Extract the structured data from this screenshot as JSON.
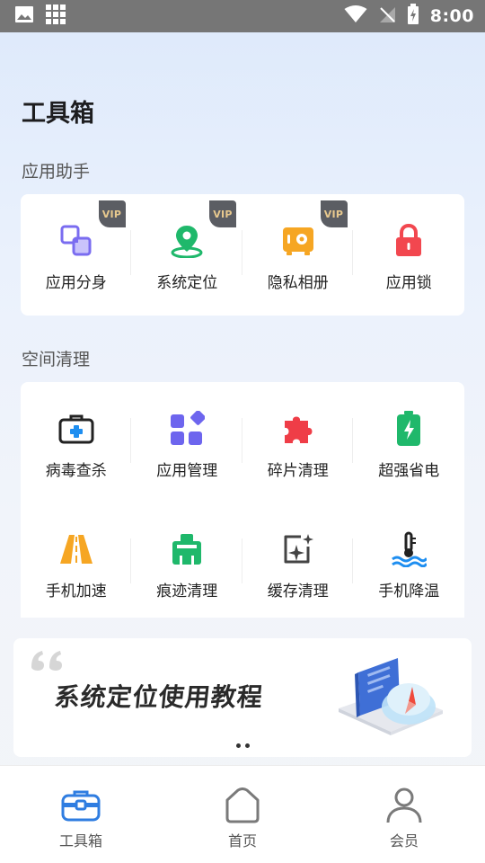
{
  "status_bar": {
    "time": "8:00"
  },
  "page": {
    "title": "工具箱"
  },
  "app_helper": {
    "title": "应用助手",
    "items": [
      {
        "label": "应用分身",
        "icon": "app-clone-icon",
        "vip": "VIP"
      },
      {
        "label": "系统定位",
        "icon": "location-pin-icon",
        "vip": "VIP"
      },
      {
        "label": "隐私相册",
        "icon": "private-album-icon",
        "vip": "VIP"
      },
      {
        "label": "应用锁",
        "icon": "lock-icon"
      }
    ]
  },
  "space_clean": {
    "title": "空间清理",
    "items": [
      {
        "label": "病毒查杀",
        "icon": "medkit-icon"
      },
      {
        "label": "应用管理",
        "icon": "app-grid-icon"
      },
      {
        "label": "碎片清理",
        "icon": "puzzle-icon"
      },
      {
        "label": "超强省电",
        "icon": "battery-icon"
      },
      {
        "label": "手机加速",
        "icon": "road-speed-icon"
      },
      {
        "label": "痕迹清理",
        "icon": "broom-icon"
      },
      {
        "label": "缓存清理",
        "icon": "cache-sparkle-icon"
      },
      {
        "label": "手机降温",
        "icon": "thermometer-icon"
      }
    ]
  },
  "banner": {
    "text": "系统定位使用教程",
    "page_count": 2
  },
  "tabbar": {
    "items": [
      {
        "label": "工具箱",
        "icon": "toolbox-icon",
        "active": true
      },
      {
        "label": "首页",
        "icon": "home-icon",
        "active": false
      },
      {
        "label": "会员",
        "icon": "member-icon",
        "active": false
      }
    ]
  },
  "colors": {
    "accent": "#2f7de1",
    "vip_badge_bg": "#5b5d63",
    "vip_badge_text": "#e8c98e"
  }
}
